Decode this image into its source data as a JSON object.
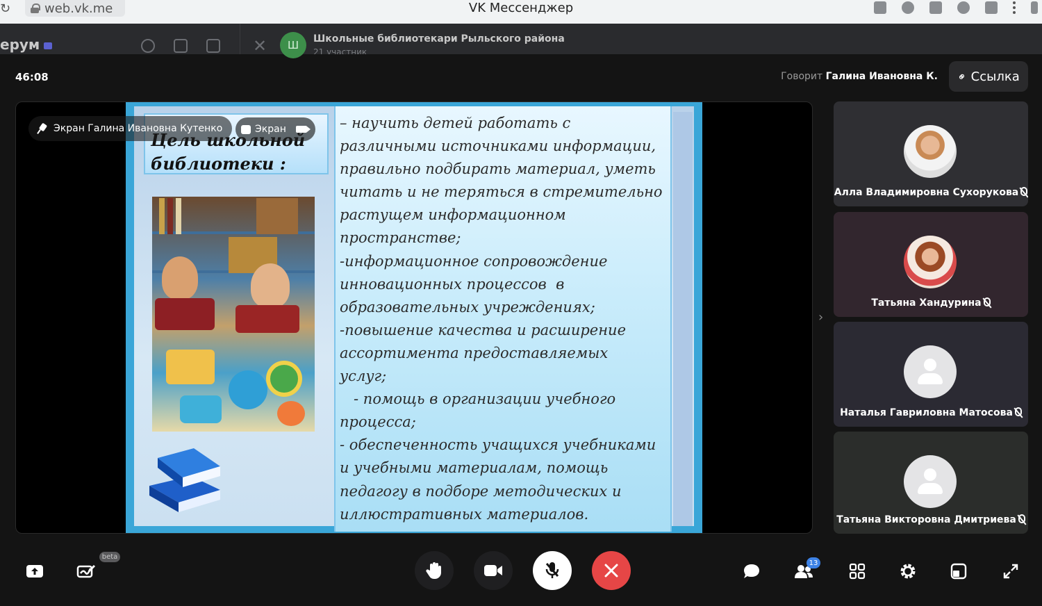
{
  "browser": {
    "url": "web.vk.me",
    "title": "VK Мессенджер"
  },
  "chat": {
    "brand": "ерум",
    "avatar_letter": "Ш",
    "name": "Школьные библиотекари Рыльского района",
    "subtitle": "21 участник"
  },
  "call": {
    "timer": "46:08",
    "speaking_prefix": "Говорит",
    "speaking_name": "Галина Ивановна К.",
    "link_label": "Ссылка"
  },
  "share": {
    "owner_label": "Экран Галина Ивановна Кутенко",
    "screen_label": "Экран"
  },
  "slide": {
    "title": "Цель школьной библиотеки :",
    "lines": [
      "– научить детей работать с",
      "различными источниками информации,",
      "правильно подбирать материал, уметь",
      "читать и не теряться в стремительно",
      "растущем информационном",
      "пространстве;",
      "-информационное сопровождение",
      "инновационных процессов  в",
      "образовательных учреждениях;",
      "-повышение качества и расширение",
      "ассортимента предоставляемых",
      "услуг;",
      "   - помощь в организации учебного",
      "процесса;",
      "- обеспеченность учащихся учебниками",
      "и учебными материалам, помощь",
      "педагогу в подборе методических и",
      "иллюстративных материалов."
    ]
  },
  "participants": [
    {
      "name": "Алла Владимировна Сухорукова",
      "avatar": "photo"
    },
    {
      "name": "Татьяна Хандурина",
      "avatar": "photo"
    },
    {
      "name": "Наталья Гавриловна Матосова",
      "avatar": "placeholder"
    },
    {
      "name": "Татьяна Викторовна Дмитриева",
      "avatar": "placeholder"
    }
  ],
  "toolbar": {
    "beta_label": "beta",
    "participants_count": "13"
  },
  "colors": {
    "end_call": "#e64646",
    "badge": "#3d82e6",
    "slide_frame": "#3aa6d8"
  }
}
